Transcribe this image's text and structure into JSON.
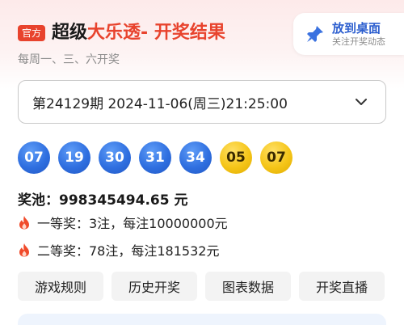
{
  "header": {
    "badge": "官方",
    "title_part1": "超级",
    "title_part2": "大乐透",
    "title_part3": " - 开奖结果",
    "subtitle": "每周一、三、六开奖",
    "desktop_button": {
      "label": "放到桌面",
      "sublabel": "关注开奖动态"
    }
  },
  "period_select": {
    "value": "第24129期 2024-11-06(周三)21:25:00"
  },
  "balls": {
    "front": [
      "07",
      "19",
      "30",
      "31",
      "34"
    ],
    "back": [
      "05",
      "07"
    ]
  },
  "pool": {
    "text": "奖池：998345494.65 元"
  },
  "prizes": [
    {
      "text": "一等奖：3注，每注10000000元"
    },
    {
      "text": "二等奖：78注，每注181532元"
    }
  ],
  "actions": [
    "游戏规则",
    "历史开奖",
    "图表数据",
    "开奖直播"
  ],
  "colors": {
    "accent_red": "#e8432d",
    "front_ball": "#2f6fe0",
    "back_ball": "#f5c518",
    "link_blue": "#2d5fcf"
  },
  "icons": {
    "pin": "pin-icon",
    "chevron": "chevron-down-icon",
    "fire": "fire-icon"
  }
}
